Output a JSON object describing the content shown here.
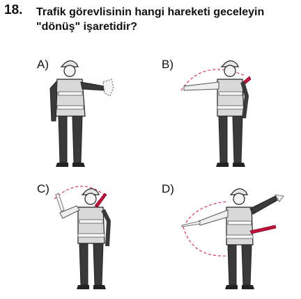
{
  "question": {
    "number": "18.",
    "text_line1": "Trafik görevlisinin hangi hareketi geceleyin",
    "text_line2": "\"dönüş\" işaretidir?"
  },
  "options": [
    {
      "label": "A)",
      "figure": "officer-arm-out-palm"
    },
    {
      "label": "B)",
      "figure": "officer-baton-arc-horizontal"
    },
    {
      "label": "C)",
      "figure": "officer-baton-arc-overhead"
    },
    {
      "label": "D)",
      "figure": "officer-both-arms-baton-arc"
    }
  ],
  "colors": {
    "vest": "#d9d9d9",
    "reflective": "#f2f2f2",
    "dark": "#3a3a3a",
    "baton": "#c0143c",
    "arc": "#d63a5a"
  }
}
